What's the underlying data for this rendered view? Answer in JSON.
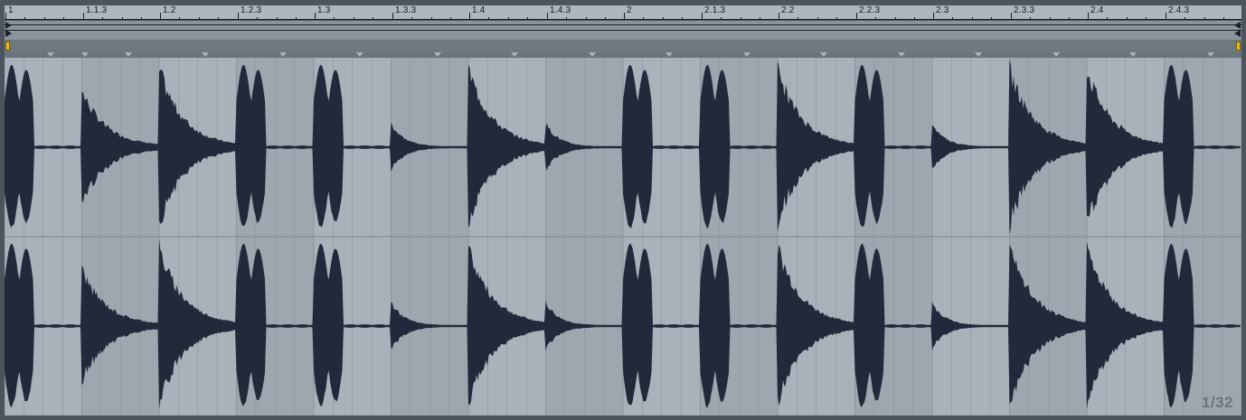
{
  "ruler": {
    "labels": [
      "1",
      "1.1.3",
      "1.2",
      "1.2.3",
      "1.3",
      "1.3.3",
      "1.4",
      "1.4.3",
      "2",
      "2.1.3",
      "2.2",
      "2.2.3",
      "2.3",
      "2.3.3",
      "2.4",
      "2.4.3"
    ]
  },
  "waveform": {
    "channels": 2,
    "hits": [
      {
        "amp": 1.0,
        "decay": "short"
      },
      {
        "amp": 0.72,
        "decay": "long"
      },
      {
        "amp": 1.0,
        "decay": "long"
      },
      {
        "amp": 1.0,
        "decay": "short"
      },
      {
        "amp": 1.0,
        "decay": "short"
      },
      {
        "amp": 0.3,
        "decay": "medium"
      },
      {
        "amp": 1.0,
        "decay": "long"
      },
      {
        "amp": 0.3,
        "decay": "medium"
      },
      {
        "amp": 1.0,
        "decay": "short"
      },
      {
        "amp": 1.0,
        "decay": "short"
      },
      {
        "amp": 1.0,
        "decay": "long"
      },
      {
        "amp": 1.0,
        "decay": "short"
      },
      {
        "amp": 0.28,
        "decay": "medium"
      },
      {
        "amp": 1.0,
        "decay": "long"
      },
      {
        "amp": 1.0,
        "decay": "long"
      },
      {
        "amp": 1.0,
        "decay": "short"
      }
    ]
  },
  "colors": {
    "wave": "#22293a",
    "slice_light": "#a9b2ba",
    "slice_dark": "#9ea7af",
    "grid": "#8c959d",
    "marker": "#f0b91a"
  },
  "grid": {
    "zoom_label": "1/32"
  }
}
